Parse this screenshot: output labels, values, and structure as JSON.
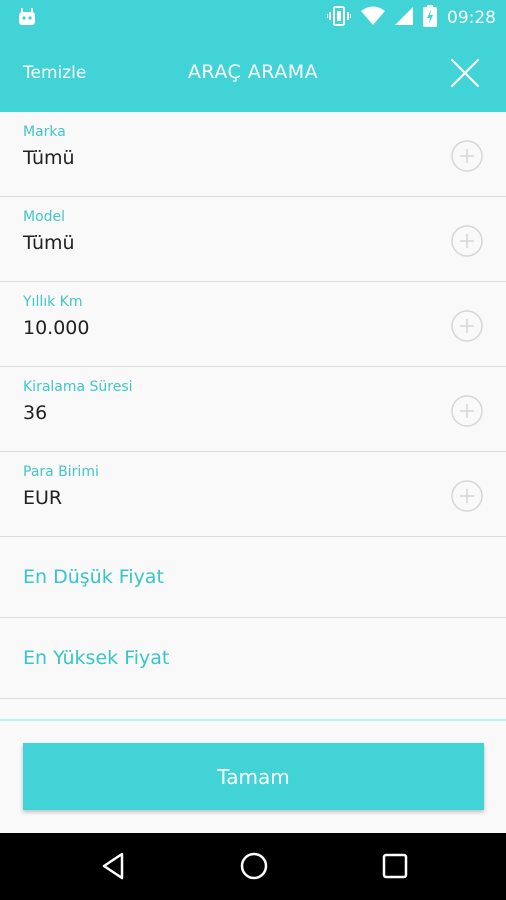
{
  "status_bar": {
    "time": "09:28",
    "icons": [
      "android-icon",
      "vibrate-icon",
      "wifi-icon",
      "signal-icon",
      "battery-icon"
    ]
  },
  "app_bar": {
    "clear_label": "Temizle",
    "title": "ARAÇ ARAMA",
    "close_icon": "close-icon"
  },
  "form": {
    "fields": [
      {
        "label": "Marka",
        "value": "Tümü"
      },
      {
        "label": "Model",
        "value": "Tümü"
      },
      {
        "label": "Yıllık Km",
        "value": "10.000"
      },
      {
        "label": "Kiralama Süresi",
        "value": "36"
      },
      {
        "label": "Para Birimi",
        "value": "EUR"
      }
    ],
    "price_inputs": [
      {
        "placeholder": "En Düşük Fiyat"
      },
      {
        "placeholder": "En Yüksek Fiyat"
      }
    ]
  },
  "footer": {
    "ok_label": "Tamam"
  },
  "nav_bar": {
    "icons": [
      "back-icon",
      "home-icon",
      "recents-icon"
    ]
  },
  "colors": {
    "accent": "#41d3d5",
    "label": "#41c7ca",
    "text": "#222222",
    "background": "#f9f9f9"
  }
}
